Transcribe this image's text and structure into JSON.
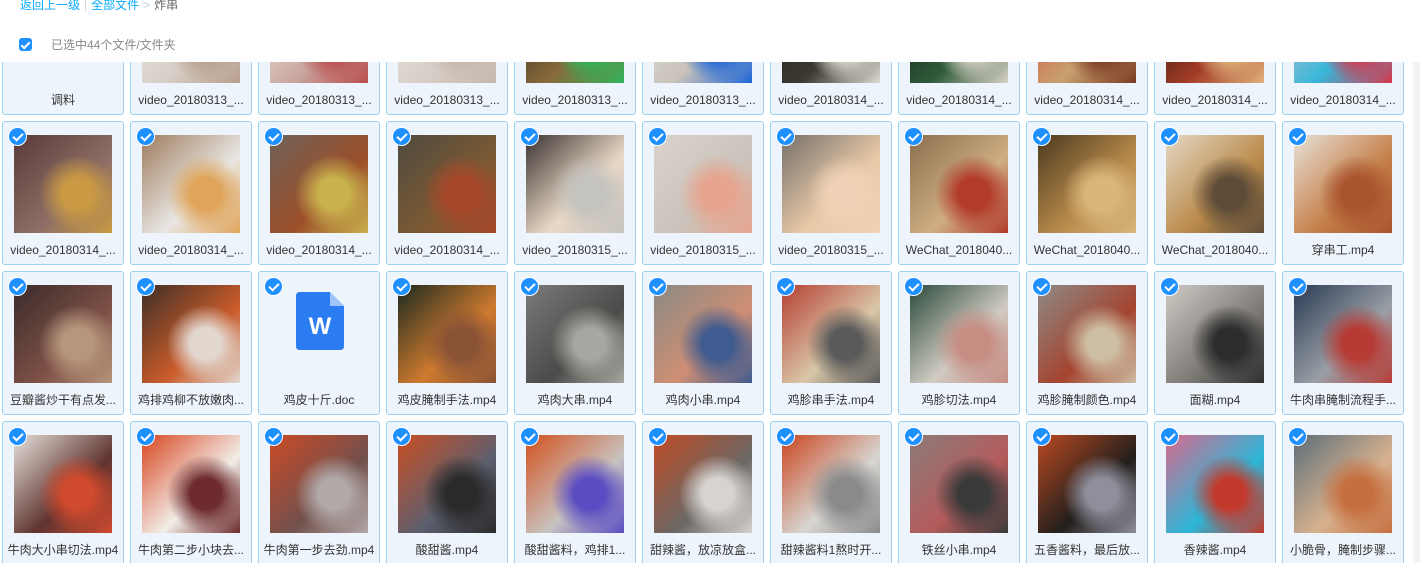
{
  "breadcrumb": {
    "back_label": "返回上一级",
    "separator": "|",
    "all_files_label": "全部文件",
    "arrow": ">",
    "current_folder": "炸串"
  },
  "selection": {
    "text": "已选中44个文件/文件夹"
  },
  "files": [
    {
      "name": "调料",
      "kind": "folder",
      "selected": false,
      "thumb": [
        "#ffffff",
        "#ffffff",
        "#ffffff"
      ]
    },
    {
      "name": "video_20180313_...",
      "kind": "video",
      "selected": false,
      "thumb": [
        "#f1eeea",
        "#d6cfc7",
        "#b89e8c"
      ]
    },
    {
      "name": "video_20180313_...",
      "kind": "video",
      "selected": false,
      "thumb": [
        "#f4efec",
        "#c9a8a0",
        "#b94d4d"
      ]
    },
    {
      "name": "video_20180313_...",
      "kind": "video",
      "selected": false,
      "thumb": [
        "#eee9e4",
        "#d7cfc8",
        "#c5b8ad"
      ]
    },
    {
      "name": "video_20180313_...",
      "kind": "video",
      "selected": false,
      "thumb": [
        "#24251f",
        "#8a6a3b",
        "#2fb45a"
      ]
    },
    {
      "name": "video_20180313_...",
      "kind": "video",
      "selected": false,
      "thumb": [
        "#e7e4de",
        "#c8c2b9",
        "#1e66d8"
      ]
    },
    {
      "name": "video_20180314_...",
      "kind": "video",
      "selected": false,
      "thumb": [
        "#1f1b17",
        "#3c3a33",
        "#e0dbd3"
      ]
    },
    {
      "name": "video_20180314_...",
      "kind": "video",
      "selected": false,
      "thumb": [
        "#151914",
        "#2e5a3a",
        "#d9d2c6"
      ]
    },
    {
      "name": "video_20180314_...",
      "kind": "video",
      "selected": false,
      "thumb": [
        "#d6463a",
        "#c8a06f",
        "#7a3a22"
      ]
    },
    {
      "name": "video_20180314_...",
      "kind": "video",
      "selected": false,
      "thumb": [
        "#161212",
        "#a33c26",
        "#dfb27c"
      ]
    },
    {
      "name": "video_20180314_...",
      "kind": "video",
      "selected": false,
      "thumb": [
        "#e3c8d2",
        "#37b6d9",
        "#d8374d"
      ]
    },
    {
      "name": "video_20180314_...",
      "kind": "video",
      "selected": true,
      "thumb": [
        "#5a3a38",
        "#8d6d66",
        "#c99a43"
      ]
    },
    {
      "name": "video_20180314_...",
      "kind": "video",
      "selected": true,
      "thumb": [
        "#9f7c5f",
        "#e8e6e2",
        "#e0a45a"
      ]
    },
    {
      "name": "video_20180314_...",
      "kind": "video",
      "selected": true,
      "thumb": [
        "#6e6258",
        "#9c4f2a",
        "#c9b24d"
      ]
    },
    {
      "name": "video_20180314_...",
      "kind": "video",
      "selected": true,
      "thumb": [
        "#4e4a3f",
        "#7b5a33",
        "#a8482a"
      ]
    },
    {
      "name": "video_20180315_...",
      "kind": "video",
      "selected": true,
      "thumb": [
        "#3b3431",
        "#e9d8c6",
        "#c4c3be"
      ]
    },
    {
      "name": "video_20180315_...",
      "kind": "video",
      "selected": true,
      "thumb": [
        "#d9d3cc",
        "#cbc3bb",
        "#e7a48e"
      ]
    },
    {
      "name": "video_20180315_...",
      "kind": "video",
      "selected": true,
      "thumb": [
        "#76706a",
        "#e8c8a7",
        "#f0d2b6"
      ]
    },
    {
      "name": "WeChat_2018040...",
      "kind": "video",
      "selected": true,
      "thumb": [
        "#8a6f4c",
        "#cfae84",
        "#b23b2a"
      ]
    },
    {
      "name": "WeChat_2018040...",
      "kind": "video",
      "selected": true,
      "thumb": [
        "#4c3a1f",
        "#b98b4b",
        "#d9b77c"
      ]
    },
    {
      "name": "WeChat_2018040...",
      "kind": "video",
      "selected": true,
      "thumb": [
        "#e4d8c4",
        "#ba8a4a",
        "#5e4c38"
      ]
    },
    {
      "name": "穿串工.mp4",
      "kind": "video",
      "selected": true,
      "thumb": [
        "#e7e1d5",
        "#c57f47",
        "#a9532f"
      ]
    },
    {
      "name": "豆瓣酱炒干有点发...",
      "kind": "video",
      "selected": true,
      "thumb": [
        "#3a2b2b",
        "#7d5046",
        "#b7967c"
      ]
    },
    {
      "name": "鸡排鸡柳不放嫩肉...",
      "kind": "video",
      "selected": true,
      "thumb": [
        "#3f2f25",
        "#c95b2b",
        "#e2d7cf"
      ]
    },
    {
      "name": "鸡皮十斤.doc",
      "kind": "doc",
      "selected": true,
      "thumb": [
        "#eef4fb",
        "#eef4fb",
        "#eef4fb"
      ]
    },
    {
      "name": "鸡皮腌制手法.mp4",
      "kind": "video",
      "selected": true,
      "thumb": [
        "#1b2a1e",
        "#cf7a2f",
        "#8a5336"
      ]
    },
    {
      "name": "鸡肉大串.mp4",
      "kind": "video",
      "selected": true,
      "thumb": [
        "#7a7c7a",
        "#4b4b49",
        "#a8a6a0"
      ]
    },
    {
      "name": "鸡肉小串.mp4",
      "kind": "video",
      "selected": true,
      "thumb": [
        "#8a8a84",
        "#cf8e73",
        "#3f5b8f"
      ]
    },
    {
      "name": "鸡胗串手法.mp4",
      "kind": "video",
      "selected": true,
      "thumb": [
        "#b53f33",
        "#d9c7a7",
        "#5a5a5a"
      ]
    },
    {
      "name": "鸡胗切法.mp4",
      "kind": "video",
      "selected": true,
      "thumb": [
        "#2a4a3a",
        "#d0cbc3",
        "#c68d82"
      ]
    },
    {
      "name": "鸡胗腌制颜色.mp4",
      "kind": "video",
      "selected": true,
      "thumb": [
        "#8d8a86",
        "#a4442f",
        "#cdbda2"
      ]
    },
    {
      "name": "面糊.mp4",
      "kind": "video",
      "selected": true,
      "thumb": [
        "#cfcac4",
        "#7d7a76",
        "#2d2d2d"
      ]
    },
    {
      "name": "牛肉串腌制流程手...",
      "kind": "video",
      "selected": true,
      "thumb": [
        "#2a3a54",
        "#9a9fa6",
        "#b73b35"
      ]
    },
    {
      "name": "牛肉大小串切法.mp4",
      "kind": "video",
      "selected": true,
      "thumb": [
        "#e6e1db",
        "#5f3430",
        "#d04a2e"
      ]
    },
    {
      "name": "牛肉第二步小块去...",
      "kind": "video",
      "selected": true,
      "thumb": [
        "#d8451f",
        "#f2ede8",
        "#6d2b2d"
      ]
    },
    {
      "name": "牛肉第一步去劲.mp4",
      "kind": "video",
      "selected": true,
      "thumb": [
        "#cc4a24",
        "#72514c",
        "#b1a8a8"
      ]
    },
    {
      "name": "酸甜酱.mp4",
      "kind": "video",
      "selected": true,
      "thumb": [
        "#c94f22",
        "#5c5f6f",
        "#2a2a2a"
      ]
    },
    {
      "name": "酸甜酱料，鸡排1...",
      "kind": "video",
      "selected": true,
      "thumb": [
        "#d2521e",
        "#c7c3c0",
        "#5a4cc2"
      ]
    },
    {
      "name": "甜辣酱，放凉放盒...",
      "kind": "video",
      "selected": true,
      "thumb": [
        "#c04a24",
        "#6a6865",
        "#d7d3cf"
      ]
    },
    {
      "name": "甜辣酱料1熬时开...",
      "kind": "video",
      "selected": true,
      "thumb": [
        "#c9461f",
        "#d8d6d2",
        "#8a8a8a"
      ]
    },
    {
      "name": "铁丝小串.mp4",
      "kind": "video",
      "selected": true,
      "thumb": [
        "#8c7b7a",
        "#b45b5b",
        "#3a3a3a"
      ]
    },
    {
      "name": "五香酱料，最后放...",
      "kind": "video",
      "selected": true,
      "thumb": [
        "#bb4a22",
        "#221f1c",
        "#8f8f9c"
      ]
    },
    {
      "name": "香辣酱.mp4",
      "kind": "video",
      "selected": true,
      "thumb": [
        "#d86a8d",
        "#2cb6d8",
        "#c23a2d"
      ]
    },
    {
      "name": "小脆骨，腌制步骤...",
      "kind": "video",
      "selected": true,
      "thumb": [
        "#5d6e7a",
        "#d7b18f",
        "#c56f3f"
      ]
    }
  ]
}
